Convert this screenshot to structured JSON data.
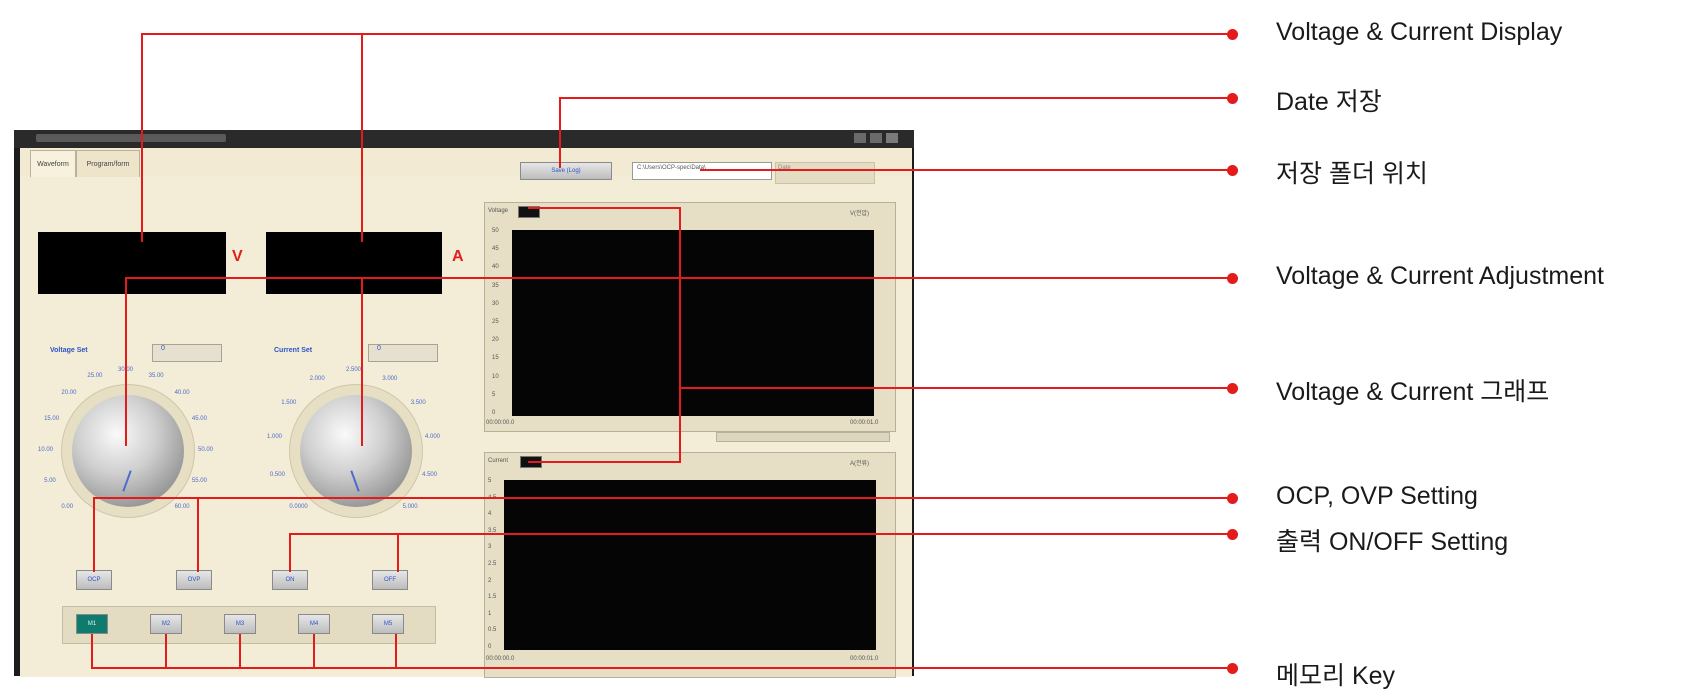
{
  "window": {
    "tabs": [
      {
        "label": "Waveform"
      },
      {
        "label": "Program/form"
      }
    ],
    "save_button_label": "Save (Log)",
    "folder_path": "C:\\Users\\OCP-spec\\Data\\",
    "folder_extra": "Date"
  },
  "display": {
    "voltage_unit": "V",
    "current_unit": "A"
  },
  "controls": {
    "voltage_set_label": "Voltage Set",
    "current_set_label": "Current Set",
    "voltage_set_value": "0",
    "current_set_value": "0",
    "voltage_ticks": [
      "0.00",
      "5.00",
      "10.00",
      "15.00",
      "20.00",
      "25.00",
      "30.00",
      "35.00",
      "40.00",
      "45.00",
      "50.00",
      "55.00",
      "60.00"
    ],
    "current_ticks": [
      "0.0000",
      "0.500",
      "1.000",
      "1.500",
      "2.000",
      "2.500",
      "3.000",
      "3.500",
      "4.000",
      "4.500",
      "5.000"
    ],
    "ocp_label": "OCP",
    "ovp_label": "OVP",
    "on_label": "ON",
    "off_label": "OFF",
    "memory_keys": [
      "M1",
      "M2",
      "M3",
      "M4",
      "M5"
    ]
  },
  "graphs": {
    "voltage_label": "Voltage",
    "current_label": "Current",
    "voltage_right_label": "V(전압)",
    "current_right_label": "A(전류)",
    "voltage_y_ticks": [
      "50",
      "45",
      "40",
      "35",
      "30",
      "25",
      "20",
      "15",
      "10",
      "5",
      "0"
    ],
    "current_y_ticks": [
      "5",
      "4.5",
      "4",
      "3.5",
      "3",
      "2.5",
      "2",
      "1.5",
      "1",
      "0.5",
      "0"
    ],
    "time_start": "00:00:00.0",
    "time_end": "00:00:01.0"
  },
  "callouts": [
    {
      "label": "Voltage & Current Display"
    },
    {
      "label": "Date 저장"
    },
    {
      "label": "저장 폴더 위치"
    },
    {
      "label": "Voltage & Current Adjustment"
    },
    {
      "label": "Voltage & Current 그래프"
    },
    {
      "label": "OCP, OVP Setting"
    },
    {
      "label": "출력 ON/OFF Setting"
    },
    {
      "label": "메모리 Key"
    }
  ],
  "colors": {
    "callout_line": "#e41b1b",
    "panel_bg": "#f2ead2",
    "lcd": "#000000",
    "accent_text": "#2d54c9",
    "memory_active": "#0f7a6e"
  }
}
